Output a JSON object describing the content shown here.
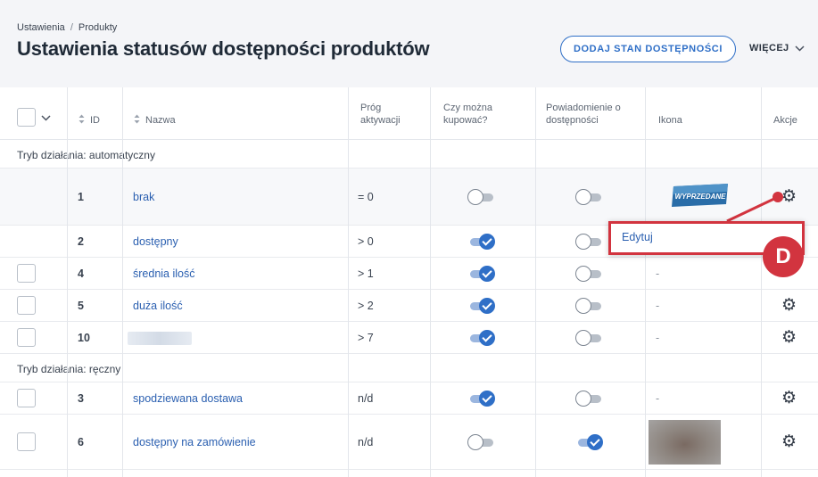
{
  "breadcrumb": {
    "settings": "Ustawienia",
    "separator": "/",
    "products": "Produkty"
  },
  "page_title": "Ustawienia statusów dostępności produktów",
  "toolbar": {
    "add_label": "DODAJ STAN DOSTĘPNOŚCI",
    "more_label": "WIĘCEJ"
  },
  "columns": {
    "id": "ID",
    "name": "Nazwa",
    "threshold_1": "Próg",
    "threshold_2": "aktywacji",
    "can_buy_1": "Czy można",
    "can_buy_2": "kupować?",
    "notify_1": "Powiadomienie o",
    "notify_2": "dostępności",
    "icon": "Ikona",
    "actions": "Akcje"
  },
  "groups": {
    "auto": "Tryb działania: automatyczny",
    "manual": "Tryb działania: ręczny"
  },
  "rows": [
    {
      "id": "1",
      "name": "brak",
      "threshold": "= 0",
      "can_buy": false,
      "notify": false,
      "icon": "wyprzedane-icon"
    },
    {
      "id": "2",
      "name": "dostępny",
      "threshold": "> 0",
      "can_buy": true,
      "notify": false,
      "icon": ""
    },
    {
      "id": "4",
      "name": "średnia ilość",
      "threshold": "> 1",
      "can_buy": true,
      "notify": false,
      "icon": "-"
    },
    {
      "id": "5",
      "name": "duża ilość",
      "threshold": "> 2",
      "can_buy": true,
      "notify": false,
      "icon": "-"
    },
    {
      "id": "10",
      "name": "",
      "threshold": "> 7",
      "can_buy": true,
      "notify": false,
      "icon": "-"
    },
    {
      "id": "3",
      "name": "spodziewana dostawa",
      "threshold": "n/d",
      "can_buy": true,
      "notify": false,
      "icon": "-"
    },
    {
      "id": "6",
      "name": "dostępny na zamówienie",
      "threshold": "n/d",
      "can_buy": false,
      "notify": true,
      "icon": "blurred-image"
    }
  ],
  "dropdown": {
    "edit_label": "Edytuj"
  },
  "badge": {
    "label": "D"
  },
  "wyprzedane_label": "WYPRZEDANE",
  "colors": {
    "accent": "#2f6fc7",
    "highlight": "#d2343f"
  }
}
